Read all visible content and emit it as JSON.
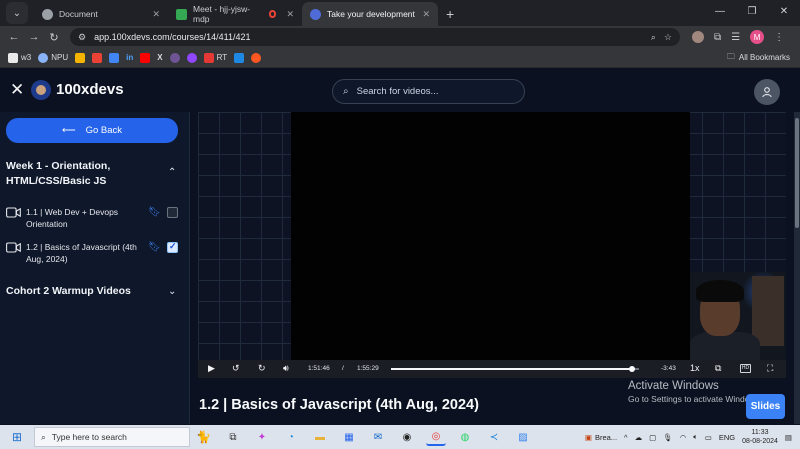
{
  "browser": {
    "tabs": [
      {
        "title": "Document",
        "favicon_color": "#9aa0a6",
        "active": false
      },
      {
        "title": "Meet - hjj-yjsw-mdp",
        "favicon_color": "#34a853",
        "active": false
      },
      {
        "title": "Take your development skills fr",
        "favicon_color": "#4f6bd8",
        "active": true
      }
    ],
    "url": "app.100xdevs.com/courses/14/411/421",
    "profile_initial": "M",
    "bookmarks": [
      {
        "label": "w3",
        "color": "#eaeaea"
      },
      {
        "label": "NPU",
        "color": "#8ab4f8"
      },
      {
        "label": "",
        "color": "#f4b400"
      },
      {
        "label": "",
        "color": "#ea4335"
      },
      {
        "label": "",
        "color": "#4285f4"
      },
      {
        "label": "in",
        "color": "#0a66c2"
      },
      {
        "label": "",
        "color": "#ff0000"
      },
      {
        "label": "X",
        "color": "#000000"
      },
      {
        "label": "",
        "color": "#6e5494"
      },
      {
        "label": "",
        "color": "#9146ff"
      },
      {
        "label": "RT",
        "color": "#e53935"
      },
      {
        "label": "",
        "color": "#1e88e5"
      },
      {
        "label": "",
        "color": "#ff5722"
      }
    ],
    "all_bookmarks": "All Bookmarks"
  },
  "app": {
    "brand": "100xdevs",
    "search_placeholder": "Search for videos...",
    "go_back": "Go Back",
    "week_title": "Week 1 - Orientation, HTML/CSS/Basic JS",
    "lessons": [
      {
        "title": "1.1 | Web Dev + Devops Orientation",
        "checked": false
      },
      {
        "title": "1.2 | Basics of Javascript (4th Aug, 2024)",
        "checked": true
      }
    ],
    "cohort_title": "Cohort 2 Warmup Videos",
    "video_title": "1.2 | Basics of Javascript (4th Aug, 2024)",
    "slides_button": "Slides"
  },
  "player": {
    "current_time": "1:51:46",
    "separator": "/",
    "duration": "1:55:29",
    "remaining": "-3:43",
    "speed": "1x",
    "progress_fraction": 0.97
  },
  "activate_windows": {
    "line1": "Activate Windows",
    "line2": "Go to Settings to activate Windows."
  },
  "taskbar": {
    "search_placeholder": "Type here to search",
    "news": "Brea...",
    "language": "ENG",
    "time": "11:33",
    "date": "08-08-2024"
  },
  "colors": {
    "accent": "#2563eb",
    "bg": "#0b1120",
    "sidebar": "#0f172a"
  }
}
